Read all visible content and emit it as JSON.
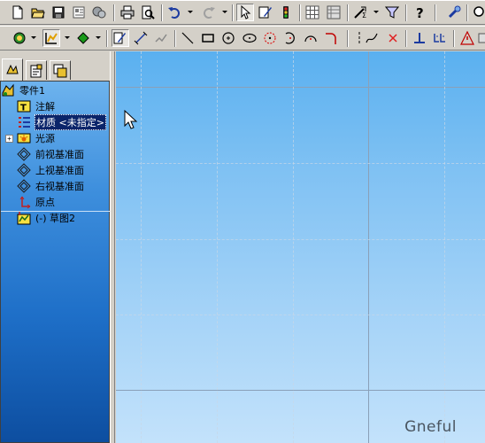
{
  "toolbar_standard": {
    "buttons": [
      "new-document-icon",
      "open-folder-icon",
      "save-icon",
      "print-preview-icon",
      "options-icon",
      "print-icon",
      "preview-icon",
      "undo-icon",
      "redo-icon",
      "select-arrow-icon",
      "sketch-pen-icon",
      "traffic-light-icon",
      "grid-icon",
      "rebuild-icon",
      "measure-icon",
      "filter-icon",
      "help-icon",
      "probe-icon",
      "zoom-icon"
    ]
  },
  "toolbar_sketch": {
    "buttons": [
      "view-orient-icon",
      "display-style-icon",
      "appearance-icon",
      "sketch-icon",
      "smart-dimension-icon",
      "relations-icon",
      "line-icon",
      "rectangle-icon",
      "circle-icon",
      "ellipse-icon",
      "point-circle-icon",
      "arc-icon",
      "tangent-arc-icon",
      "fillet-icon",
      "centerline-icon",
      "spline-icon",
      "point-x-icon",
      "add-relation-icon",
      "equation-icon",
      "warning-icon"
    ]
  },
  "panel_tabs": [
    "feature-manager-tab",
    "property-manager-tab",
    "configuration-manager-tab"
  ],
  "tree": {
    "root": "零件1",
    "items": [
      {
        "label": "注解",
        "icon": "annotations-icon"
      },
      {
        "label": "材质 <未指定>",
        "icon": "material-icon",
        "selected": true
      },
      {
        "label": "光源",
        "icon": "lights-icon",
        "expandable": true
      },
      {
        "label": "前视基准面",
        "icon": "plane-icon"
      },
      {
        "label": "上视基准面",
        "icon": "plane-icon"
      },
      {
        "label": "右视基准面",
        "icon": "plane-icon"
      },
      {
        "label": "原点",
        "icon": "origin-icon"
      },
      {
        "label": "(-) 草图2",
        "icon": "sketch-feature-icon"
      }
    ]
  },
  "watermark": "Gneful"
}
